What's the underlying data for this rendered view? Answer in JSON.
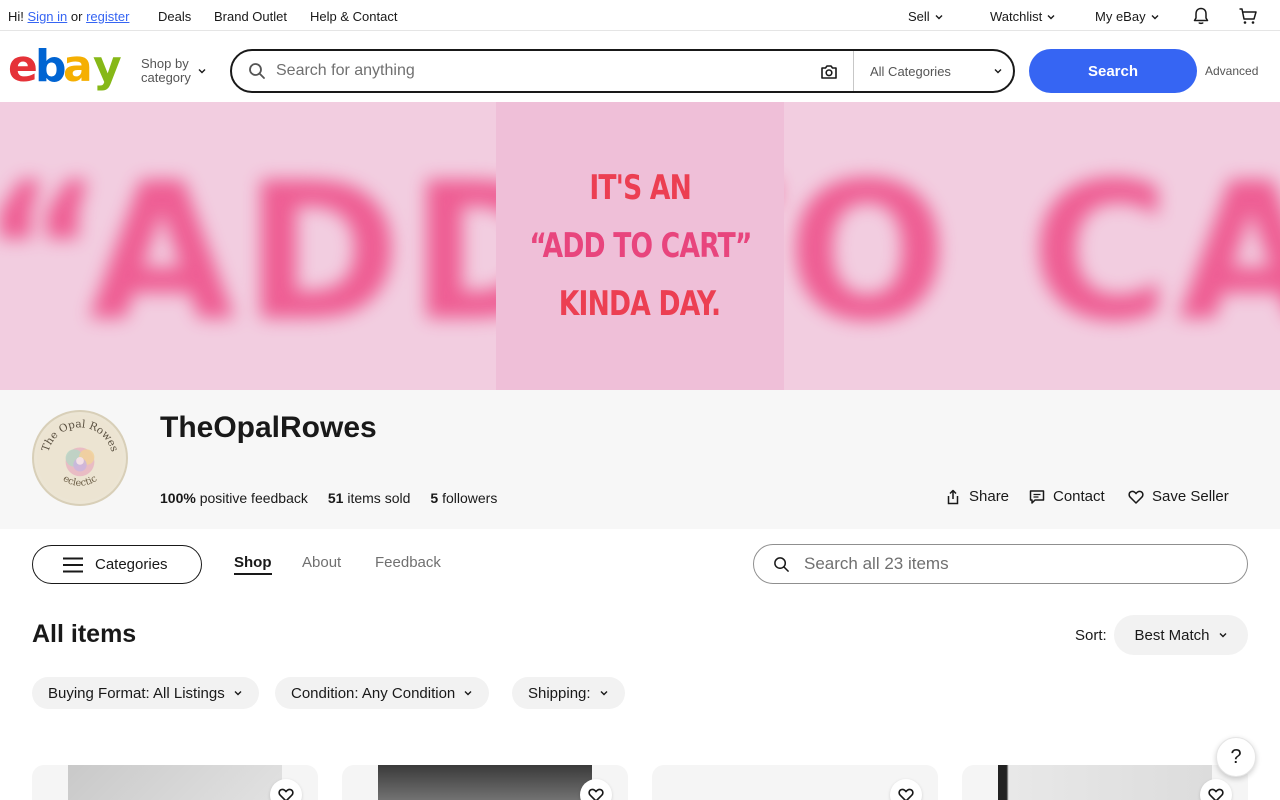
{
  "topbar": {
    "greeting": "Hi!",
    "sign_in": "Sign in",
    "or": "or",
    "register": "register",
    "links": [
      "Deals",
      "Brand Outlet",
      "Help & Contact"
    ],
    "sell": "Sell",
    "watchlist": "Watchlist",
    "my_ebay": "My eBay",
    "notification_icon": "bell-icon",
    "cart_icon": "cart-icon"
  },
  "header": {
    "logo_letters": [
      "e",
      "b",
      "a",
      "y"
    ],
    "logo_colors": [
      "#e53238",
      "#0064d2",
      "#f5af02",
      "#86b817"
    ],
    "shop_by_1": "Shop by",
    "shop_by_2": "category",
    "search_placeholder": "Search for anything",
    "category_select": "All Categories",
    "search_button": "Search",
    "advanced": "Advanced"
  },
  "banner": {
    "line1": "IT'S AN",
    "line2": "“ADD TO CART”",
    "line3": "KINDA DAY.",
    "background_text": "“ADD TO CART”",
    "accent_red": "#ec3f52",
    "accent_pink": "#e8457d"
  },
  "store": {
    "avatar_text_top": "The Opal Rowes",
    "avatar_text_bottom": "eclectic",
    "name": "TheOpalRowes",
    "feedback_value": "100%",
    "feedback_label": "positive feedback",
    "sold_value": "51",
    "sold_label": "items sold",
    "followers_value": "5",
    "followers_label": "followers",
    "share": "Share",
    "contact": "Contact",
    "save_seller": "Save Seller"
  },
  "nav": {
    "categories": "Categories",
    "tabs": [
      "Shop",
      "About",
      "Feedback"
    ],
    "active_tab": "Shop",
    "search_placeholder": "Search all 23 items"
  },
  "items": {
    "title": "All items",
    "sort_label": "Sort:",
    "sort_value": "Best Match",
    "filters": [
      "Buying Format: All Listings",
      "Condition: Any Condition",
      "Shipping:"
    ]
  },
  "help": "?",
  "colors": {
    "primary_blue": "#3665f3",
    "text": "#191919",
    "muted": "#707070"
  }
}
